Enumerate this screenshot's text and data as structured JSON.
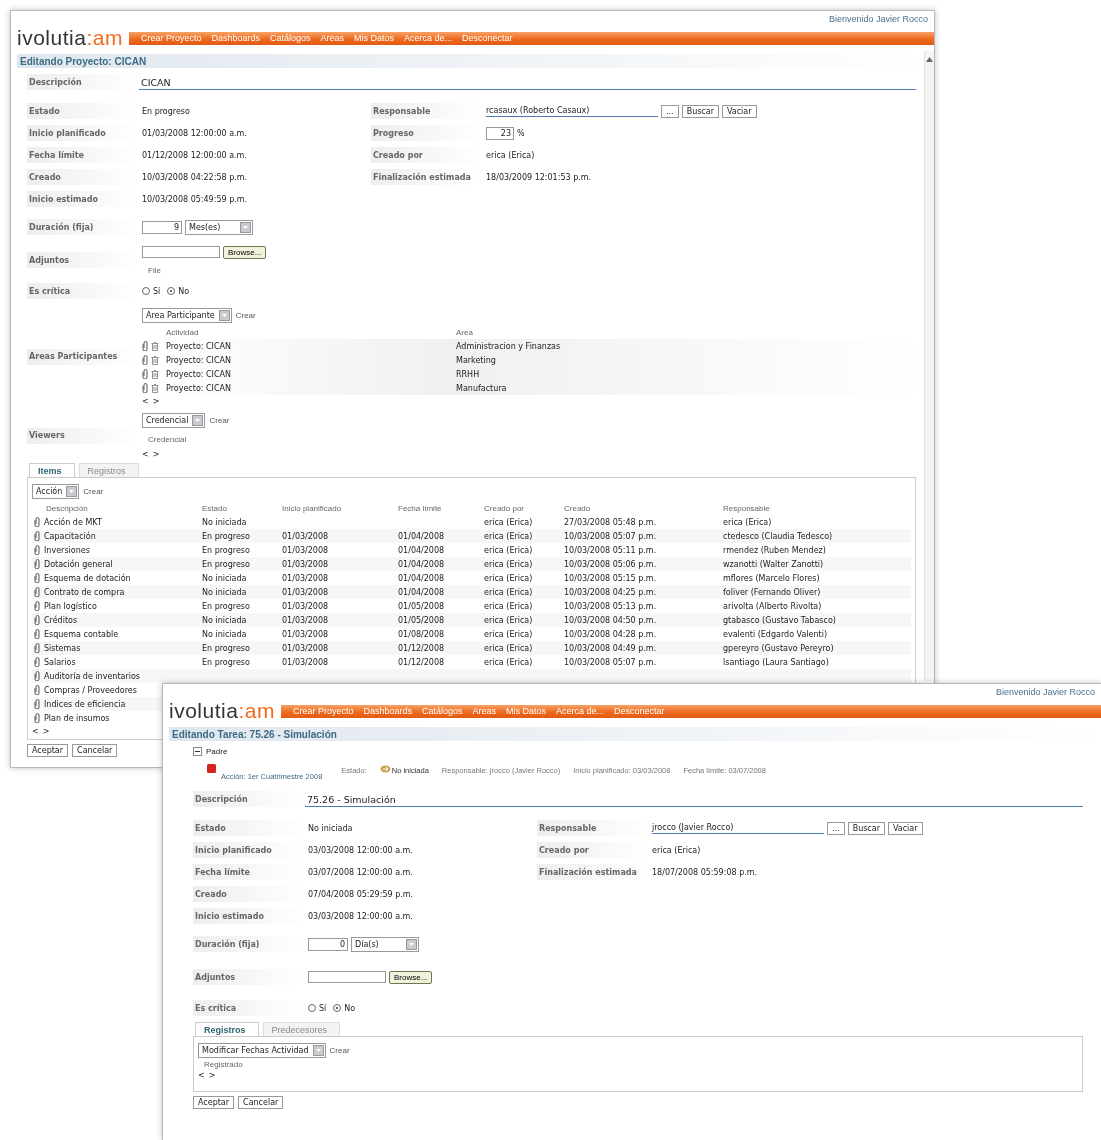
{
  "project_window": {
    "welcome": "Bienvenido Javier Rocco",
    "logo": {
      "name": "ivolutia",
      "suffix": ":am"
    },
    "nav": [
      "Crear Proyecto",
      "Dashboards",
      "Catálogos",
      "Areas",
      "Mis Datos",
      "Acerca de...",
      "Desconectar"
    ],
    "title": "Editando Proyecto: CICAN",
    "description": {
      "label": "Descripción",
      "value": "CICAN"
    },
    "fields_left": [
      {
        "label": "Estado",
        "kind": "text",
        "value": "En progreso"
      },
      {
        "label": "Inicio planificado",
        "kind": "text",
        "value": "01/03/2008 12:00:00 a.m."
      },
      {
        "label": "Fecha límite",
        "kind": "text",
        "value": "01/12/2008 12:00:00 a.m."
      },
      {
        "label": "Creado",
        "kind": "text",
        "value": "10/03/2008 04:22:58 p.m."
      },
      {
        "label": "Inicio estimado",
        "kind": "text",
        "value": "10/03/2008 05:49:59 p.m."
      }
    ],
    "fields_right": [
      {
        "label": "Responsable",
        "kind": "picker",
        "value": "rcasaux (Roberto Casaux)",
        "buttons": [
          "...",
          "Buscar",
          "Vaciar"
        ]
      },
      {
        "label": "Progreso",
        "kind": "number",
        "value": "23",
        "unit": "%"
      },
      {
        "label": "Creado por",
        "kind": "text",
        "value": "erica (Erica)"
      },
      {
        "label": "Finalización estimada",
        "kind": "text",
        "value": "18/03/2009 12:01:53 p.m."
      }
    ],
    "duration": {
      "label": "Duración (fija)",
      "value": "9",
      "unit": "Mes(es)"
    },
    "attachments": {
      "label": "Adjuntos",
      "button": "Browse...",
      "column": "File"
    },
    "critical": {
      "label": "Es crítica",
      "options": [
        {
          "label": "Sí",
          "selected": false
        },
        {
          "label": "No",
          "selected": true
        }
      ]
    },
    "areas": {
      "label": "Areas Participantes",
      "select": "Area Participante",
      "create": "Crear",
      "columns": [
        "Actividad",
        "Area"
      ],
      "rows": [
        {
          "activity": "Proyecto: CICAN",
          "area": "Administracion y Finanzas"
        },
        {
          "activity": "Proyecto: CICAN",
          "area": "Marketing"
        },
        {
          "activity": "Proyecto: CICAN",
          "area": "RRHH"
        },
        {
          "activity": "Proyecto: CICAN",
          "area": "Manufactura"
        }
      ],
      "pager": [
        "<",
        ">"
      ]
    },
    "viewers": {
      "label": "Viewers",
      "select": "Credencial",
      "create": "Crear",
      "columns": [
        "Credencial"
      ],
      "pager": [
        "<",
        ">"
      ]
    },
    "tabs": [
      {
        "label": "Items",
        "selected": true
      },
      {
        "label": "Registros",
        "selected": false
      }
    ],
    "items": {
      "select": "Acción",
      "create": "Crear",
      "columns": [
        "Descripción",
        "Estado",
        "Inicio planificado",
        "Fecha límite",
        "Creado por",
        "Creado",
        "Responsable"
      ],
      "rows": [
        {
          "cells": [
            "Acción de MKT",
            "No iniciada",
            "",
            "",
            "erica (Erica)",
            "27/03/2008 05:48 p.m.",
            "erica (Erica)"
          ]
        },
        {
          "cells": [
            "Capacitación",
            "En progreso",
            "01/03/2008",
            "01/04/2008",
            "erica (Erica)",
            "10/03/2008 05:07 p.m.",
            "ctedesco (Claudia Tedesco)"
          ]
        },
        {
          "cells": [
            "Inversiones",
            "En progreso",
            "01/03/2008",
            "01/04/2008",
            "erica (Erica)",
            "10/03/2008 05:11 p.m.",
            "rmendez (Ruben Mendez)"
          ]
        },
        {
          "cells": [
            "Dotación general",
            "En progreso",
            "01/03/2008",
            "01/04/2008",
            "erica (Erica)",
            "10/03/2008 05:06 p.m.",
            "wzanotti (Walter Zanotti)"
          ]
        },
        {
          "cells": [
            "Esquema de dotación",
            "No iniciada",
            "01/03/2008",
            "01/04/2008",
            "erica (Erica)",
            "10/03/2008 05:15 p.m.",
            "mflores (Marcelo Flores)"
          ]
        },
        {
          "cells": [
            "Contrato de compra",
            "No iniciada",
            "01/03/2008",
            "01/04/2008",
            "erica (Erica)",
            "10/03/2008 04:25 p.m.",
            "foliver (Fernando Oliver)"
          ]
        },
        {
          "cells": [
            "Plan logístico",
            "En progreso",
            "01/03/2008",
            "01/05/2008",
            "erica (Erica)",
            "10/03/2008 05:13 p.m.",
            "arivolta (Alberto Rivolta)"
          ]
        },
        {
          "cells": [
            "Créditos",
            "No iniciada",
            "01/03/2008",
            "01/05/2008",
            "erica (Erica)",
            "10/03/2008 04:50 p.m.",
            "gtabasco (Gustavo Tabasco)"
          ]
        },
        {
          "cells": [
            "Esquema contable",
            "No iniciada",
            "01/03/2008",
            "01/08/2008",
            "erica (Erica)",
            "10/03/2008 04:28 p.m.",
            "evalenti (Edgardo Valenti)"
          ]
        },
        {
          "cells": [
            "Sistemas",
            "En progreso",
            "01/03/2008",
            "01/12/2008",
            "erica (Erica)",
            "10/03/2008 04:49 p.m.",
            "gpereyro (Gustavo Pereyro)"
          ]
        },
        {
          "cells": [
            "Salarios",
            "En progreso",
            "01/03/2008",
            "01/12/2008",
            "erica (Erica)",
            "10/03/2008 05:07 p.m.",
            "lsantiago (Laura Santiago)"
          ]
        },
        {
          "cells": [
            "Auditoría de inventarios"
          ]
        },
        {
          "cells": [
            "Compras / Proveedores"
          ]
        },
        {
          "cells": [
            "Indices de eficiencia"
          ]
        },
        {
          "cells": [
            "Plan de insumos"
          ]
        }
      ],
      "pager": [
        "<",
        ">"
      ]
    },
    "buttons": [
      "Aceptar",
      "Cancelar"
    ]
  },
  "task_window": {
    "welcome": "Bienvenido Javier Rocco",
    "logo": {
      "name": "ivolutia",
      "suffix": ":am"
    },
    "nav": [
      "Crear Proyecto",
      "Dashboards",
      "Catálogos",
      "Areas",
      "Mis Datos",
      "Acerca de...",
      "Desconectar"
    ],
    "title": "Editando Tarea: 75.26 - Simulación",
    "parent": {
      "label": "Padre",
      "expanded": true,
      "name": "Acción: 1er Cuatrimestre 2008",
      "status_label": "Estado:",
      "status": "No iniciada",
      "responsible": "Responsable: jrocco (Javier Rocco)",
      "planned": "Inicio planificado: 03/03/2008",
      "deadline": "Fecha límite: 03/07/2008"
    },
    "description": {
      "label": "Descripción",
      "value": "75.26 - Simulación"
    },
    "fields_left": [
      {
        "label": "Estado",
        "kind": "text",
        "value": "No iniciada"
      },
      {
        "label": "Inicio planificado",
        "kind": "text",
        "value": "03/03/2008 12:00:00 a.m."
      },
      {
        "label": "Fecha límite",
        "kind": "text",
        "value": "03/07/2008 12:00:00 a.m."
      },
      {
        "label": "Creado",
        "kind": "text",
        "value": "07/04/2008 05:29:59 p.m."
      },
      {
        "label": "Inicio estimado",
        "kind": "text",
        "value": "03/03/2008 12:00:00 a.m."
      }
    ],
    "fields_right": [
      {
        "label": "Responsable",
        "kind": "picker",
        "value": "jrocco (Javier Rocco)",
        "buttons": [
          "...",
          "Buscar",
          "Vaciar"
        ]
      },
      {
        "label": "Creado por",
        "kind": "text",
        "value": "erica (Erica)"
      },
      {
        "label": "Finalización estimada",
        "kind": "text",
        "value": "18/07/2008 05:59:08 p.m."
      }
    ],
    "duration": {
      "label": "Duración (fija)",
      "value": "0",
      "unit": "Día(s)"
    },
    "attachments": {
      "label": "Adjuntos",
      "button": "Browse..."
    },
    "critical": {
      "label": "Es crítica",
      "options": [
        {
          "label": "Sí",
          "selected": false
        },
        {
          "label": "No",
          "selected": true
        }
      ]
    },
    "tabs": [
      {
        "label": "Registros",
        "selected": true
      },
      {
        "label": "Predecesores",
        "selected": false
      }
    ],
    "records": {
      "select": "Modificar Fechas Actividad",
      "create": "Crear",
      "columns": [
        "Registrado"
      ],
      "pager": [
        "<",
        ">"
      ]
    },
    "buttons": [
      "Aceptar",
      "Cancelar"
    ]
  }
}
